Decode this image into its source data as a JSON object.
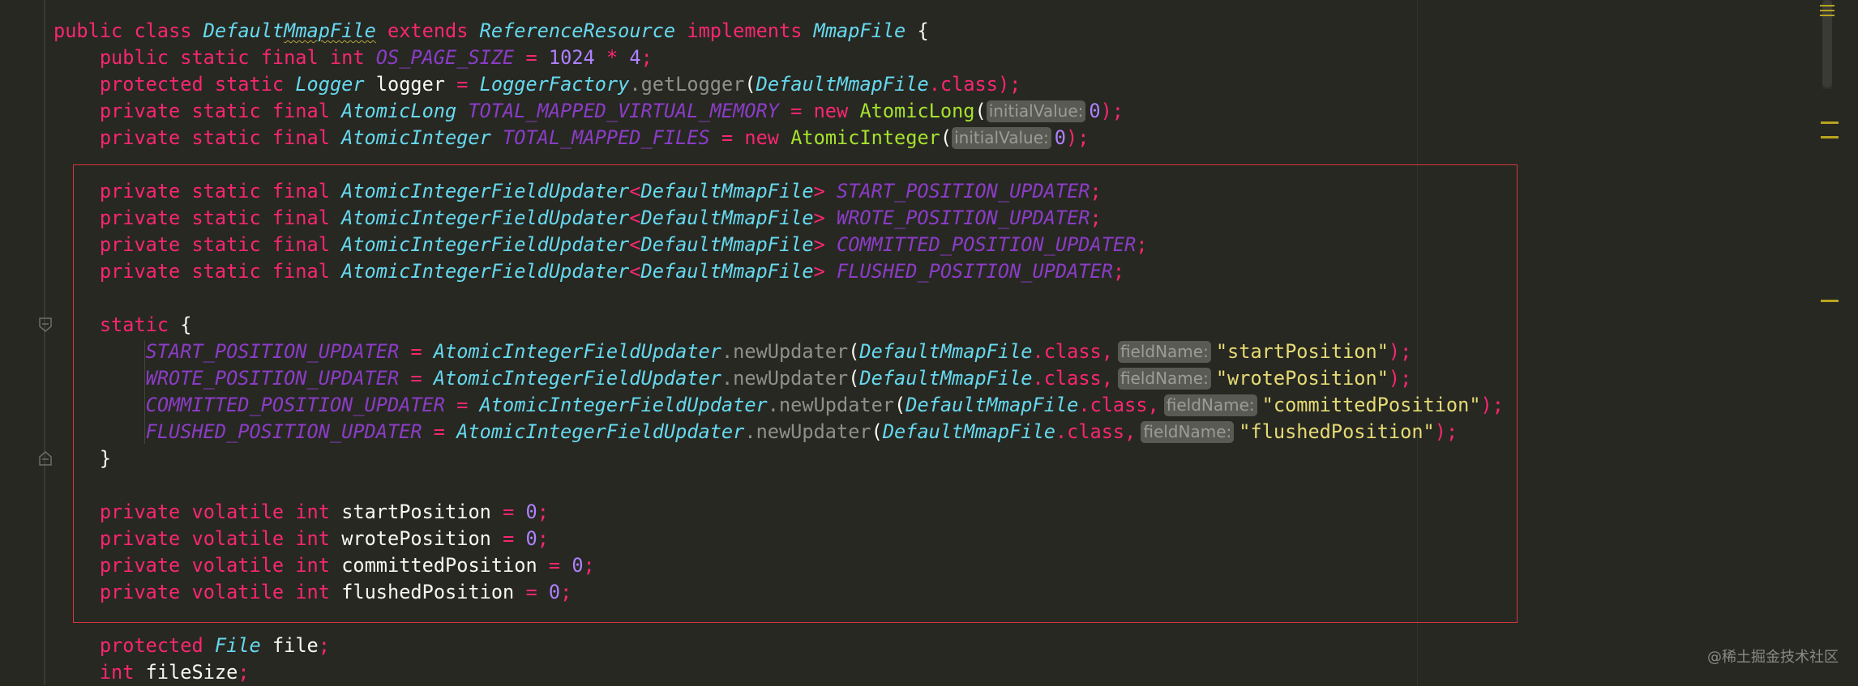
{
  "editor": {
    "class_decl": {
      "public": "public",
      "class": "class",
      "name_part1": "Default",
      "name_part2": "MmapFile",
      "extends": "extends",
      "parent": "ReferenceResource",
      "implements": "implements",
      "interface": "MmapFile",
      "brace": "{"
    },
    "fields_top": {
      "os_page_size": {
        "mods": "public static final",
        "type": "int",
        "name": "OS_PAGE_SIZE",
        "eq": "=",
        "v1": "1024",
        "op": "*",
        "v2": "4",
        "end": ";"
      },
      "logger": {
        "mods": "protected static",
        "type": "Logger",
        "name": "logger",
        "eq": "=",
        "factory": "LoggerFactory",
        "dot": ".",
        "method": "getLogger",
        "open": "(",
        "arg_class": "DefaultMmapFile",
        "class_kw": ".class",
        "close": ");"
      },
      "mapped_memory": {
        "mods": "private static final",
        "type": "AtomicLong",
        "name": "TOTAL_MAPPED_VIRTUAL_MEMORY",
        "eq": "=",
        "new": "new",
        "ctor": "AtomicLong",
        "open": "(",
        "hint": "initialValue:",
        "value": "0",
        "close": ");"
      },
      "mapped_files": {
        "mods": "private static final",
        "type": "AtomicInteger",
        "name": "TOTAL_MAPPED_FILES",
        "eq": "=",
        "new": "new",
        "ctor": "AtomicInteger",
        "open": "(",
        "hint": "initialValue:",
        "value": "0",
        "close": ");"
      }
    },
    "updaters": {
      "mods": "private static final",
      "type": "AtomicIntegerFieldUpdater",
      "lt": "<",
      "generic": "DefaultMmapFile",
      "gt": ">",
      "semi": ";",
      "names": [
        "START_POSITION_UPDATER",
        "WROTE_POSITION_UPDATER",
        "COMMITTED_POSITION_UPDATER",
        "FLUSHED_POSITION_UPDATER"
      ]
    },
    "static_block": {
      "keyword": "static",
      "open_brace": "{",
      "close_brace": "}",
      "eq": "=",
      "class_name": "AtomicIntegerFieldUpdater",
      "dot": ".",
      "method": "newUpdater",
      "paren": "(",
      "arg_class": "DefaultMmapFile",
      "class_kw": ".class,",
      "hint": "fieldName:",
      "end": ");",
      "lines": [
        {
          "target": "START_POSITION_UPDATER",
          "arg": "\"startPosition\""
        },
        {
          "target": "WROTE_POSITION_UPDATER",
          "arg": "\"wrotePosition\""
        },
        {
          "target": "COMMITTED_POSITION_UPDATER",
          "arg": "\"committedPosition\""
        },
        {
          "target": "FLUSHED_POSITION_UPDATER",
          "arg": "\"flushedPosition\""
        }
      ]
    },
    "positions": {
      "mods1": "private",
      "mods2": "volatile",
      "type": "int",
      "eq": "=",
      "value": "0",
      "semi": ";",
      "names": [
        "startPosition",
        "wrotePosition",
        "committedPosition",
        "flushedPosition"
      ]
    },
    "tail": {
      "file": {
        "mods": "protected",
        "type": "File",
        "name": "file",
        "semi": ";"
      },
      "file_size": {
        "type": "int",
        "name": "fileSize",
        "semi": ";"
      }
    }
  },
  "watermark": "@稀土掘金技术社区",
  "colors": {
    "background": "#272822",
    "keyword": "#f92672",
    "type": "#66d9ef",
    "constant": "#8b3cc7",
    "number": "#ae81ff",
    "string": "#e6db74",
    "function": "#a6e22e",
    "highlight_border": "#d4363d"
  },
  "icons": [
    "fold-start-icon",
    "fold-end-icon",
    "code-lens-icon"
  ]
}
